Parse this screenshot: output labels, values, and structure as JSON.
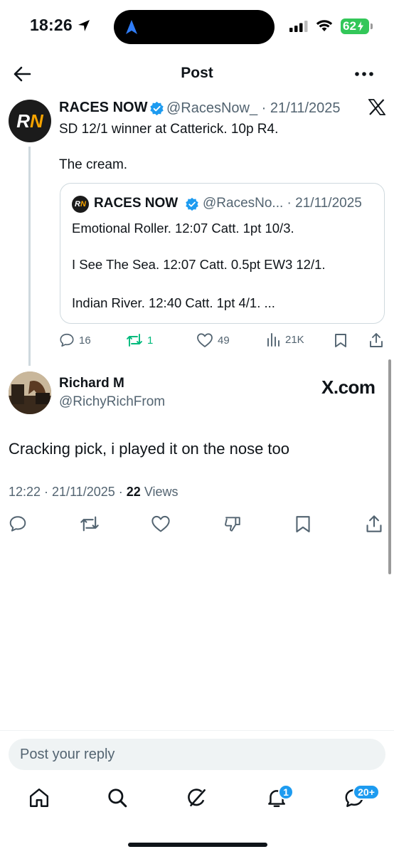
{
  "status_bar": {
    "time": "18:26",
    "battery": "62"
  },
  "header": {
    "title": "Post"
  },
  "post": {
    "name": "RACES NOW",
    "handle_date": "@RacesNow_ · 21/11/2025",
    "text_line1": "SD 12/1 winner at Catterick. 10p R4.",
    "text_line2": "The cream.",
    "quote": {
      "name": "RACES NOW",
      "handle_date": "@RacesNo... · 21/11/2025",
      "line1": "Emotional Roller. 12:07 Catt. 1pt 10/3.",
      "line2": "I See The Sea. 12:07 Catt. 0.5pt EW3 12/1.",
      "line3": "Indian River. 12:40 Catt. 1pt 4/1. ..."
    },
    "stats": {
      "replies": "16",
      "reposts": "1",
      "likes": "49",
      "views": "21K"
    }
  },
  "reply": {
    "name": "Richard M",
    "handle": "@RichyRichFrom",
    "watermark": "X.com",
    "text": "Cracking pick, i played it on the nose too",
    "meta_prefix": "12:22 · 21/11/2025 · ",
    "views_count": "22",
    "views_label": " Views"
  },
  "composer": {
    "placeholder": "Post your reply"
  },
  "bottom_nav": {
    "notif_badge": "1",
    "msg_badge": "20+"
  },
  "colors": {
    "accent": "#1d9bf0",
    "repost_green": "#00ba7c",
    "battery": "#33c759",
    "brand_orange": "#f5a300"
  }
}
